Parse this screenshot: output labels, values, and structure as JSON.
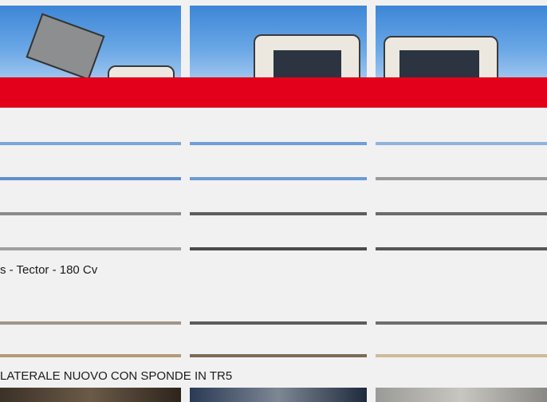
{
  "vehicle_title": "s - Tector - 180 Cv",
  "description": "LATERALE NUOVO CON SPONDE IN TR5",
  "colors": {
    "brand_red": "#e2001a",
    "background": "#f1f1f1",
    "sky": "#3d86d6"
  }
}
